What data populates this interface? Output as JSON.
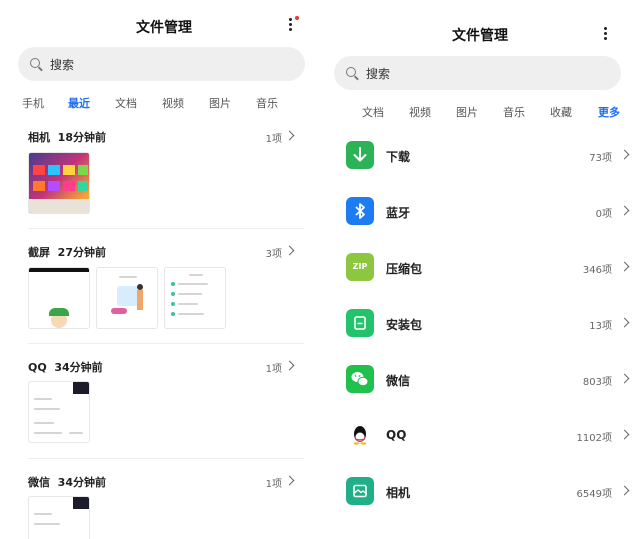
{
  "colors": {
    "accent": "#1e6ff5",
    "download": "#2db357",
    "bluetooth": "#1e7cf2",
    "zip": "#8dc63f",
    "apk": "#22c36b",
    "wechat": "#1fc04b",
    "camera": "#1fb08a"
  },
  "left": {
    "title": "文件管理",
    "search_placeholder": "搜索",
    "tabs": [
      "手机",
      "最近",
      "文档",
      "视频",
      "图片",
      "音乐"
    ],
    "active_tab": "最近",
    "sections": [
      {
        "source": "相机",
        "time": "18分钟前",
        "count": "1项"
      },
      {
        "source": "截屏",
        "time": "27分钟前",
        "count": "3项"
      },
      {
        "source": "QQ",
        "time": "34分钟前",
        "count": "1项"
      },
      {
        "source": "微信",
        "time": "34分钟前",
        "count": "1项"
      }
    ]
  },
  "right": {
    "title": "文件管理",
    "search_placeholder": "搜索",
    "tabs": [
      "文档",
      "视频",
      "图片",
      "音乐",
      "收藏",
      "更多"
    ],
    "active_tab": "更多",
    "categories": [
      {
        "label": "下载",
        "count": "73项",
        "icon": "download-icon"
      },
      {
        "label": "蓝牙",
        "count": "0项",
        "icon": "bluetooth-icon"
      },
      {
        "label": "压缩包",
        "count": "346项",
        "icon": "zip-icon",
        "icon_text": "ZIP"
      },
      {
        "label": "安装包",
        "count": "13项",
        "icon": "apk-icon"
      },
      {
        "label": "微信",
        "count": "803项",
        "icon": "wechat-icon"
      },
      {
        "label": "QQ",
        "count": "1102项",
        "icon": "qq-icon"
      },
      {
        "label": "相机",
        "count": "6549项",
        "icon": "camera-icon"
      }
    ]
  }
}
